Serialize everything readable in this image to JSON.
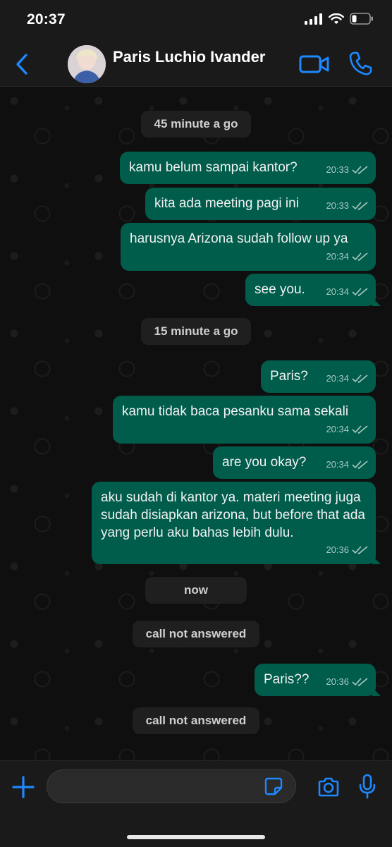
{
  "status_bar": {
    "time": "20:37"
  },
  "header": {
    "contact_name": "Paris Luchio Ivander"
  },
  "colors": {
    "accent": "#1e88ff",
    "outgoing_bubble": "#005c4b",
    "background": "#0f0f0f"
  },
  "messages": [
    {
      "type": "divider",
      "text": "45 minute a go"
    },
    {
      "type": "out",
      "text": "kamu belum sampai kantor?",
      "time": "20:33"
    },
    {
      "type": "out",
      "text": "kita ada meeting pagi ini",
      "time": "20:33"
    },
    {
      "type": "out",
      "text": "harusnya Arizona sudah follow up ya",
      "time": "20:34"
    },
    {
      "type": "out",
      "text": "see you.",
      "time": "20:34"
    },
    {
      "type": "divider",
      "text": "15 minute a go"
    },
    {
      "type": "out",
      "text": "Paris?",
      "time": "20:34"
    },
    {
      "type": "out",
      "text": "kamu tidak baca pesanku sama sekali",
      "time": "20:34"
    },
    {
      "type": "out",
      "text": "are you okay?",
      "time": "20:34"
    },
    {
      "type": "out",
      "text": "aku sudah di kantor ya. materi meeting juga sudah disiapkan arizona, but before that ada yang perlu aku bahas lebih dulu.",
      "time": "20:36"
    },
    {
      "type": "divider",
      "text": "now"
    },
    {
      "type": "divider",
      "text": "call not answered"
    },
    {
      "type": "out",
      "text": "Paris??",
      "time": "20:36"
    },
    {
      "type": "divider",
      "text": "call not answered"
    }
  ],
  "icons": {
    "back": "chevron-left-icon",
    "video": "video-camera-icon",
    "call": "phone-icon",
    "plus": "plus-icon",
    "sticker": "sticker-icon",
    "camera": "camera-icon",
    "mic": "microphone-icon"
  }
}
